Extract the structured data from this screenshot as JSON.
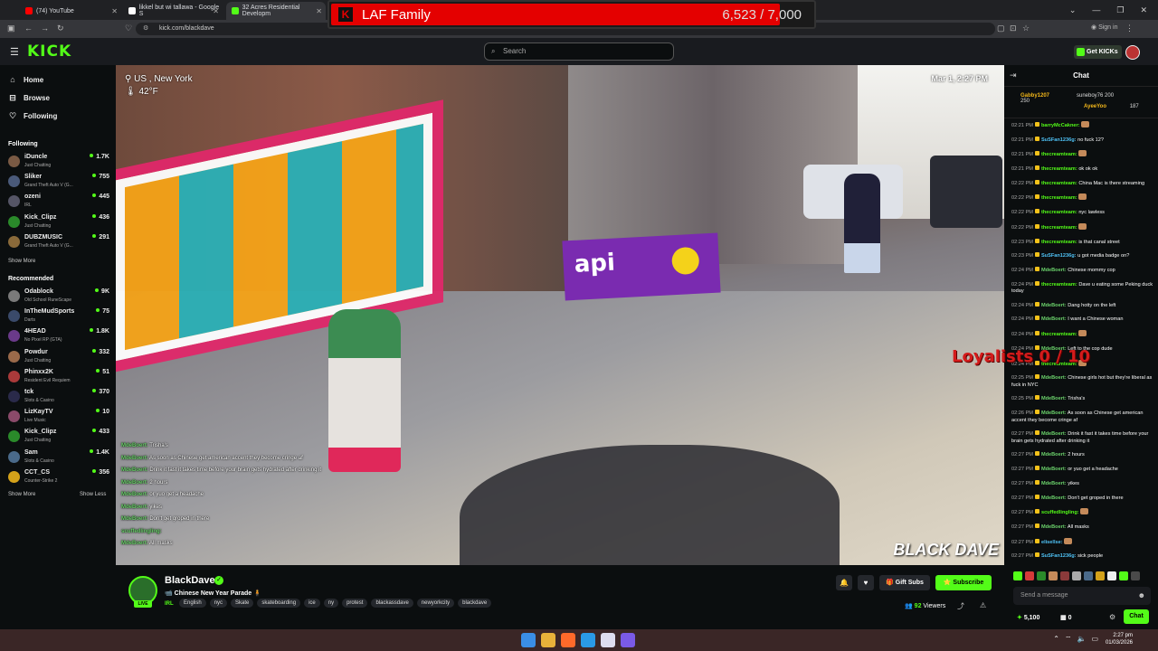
{
  "browser": {
    "tabs": [
      {
        "label": "(74) YouTube"
      },
      {
        "label": "likkel but wi tallawa - Google S"
      },
      {
        "label": "32 Acres Residential Developm"
      }
    ],
    "url": "kick.com/blackdave",
    "signin_label": "Sign in"
  },
  "laf": {
    "name": "LAF Family",
    "count": "6,523 / 7,000",
    "progress": 0.932
  },
  "kick": {
    "logo": "KICK",
    "search_placeholder": "Search",
    "get_kicks": "Get KICKs"
  },
  "sidebar": {
    "nav": [
      {
        "label": "Home",
        "icon": "home-icon"
      },
      {
        "label": "Browse",
        "icon": "browse-icon"
      },
      {
        "label": "Following",
        "icon": "heart-icon"
      }
    ],
    "following_title": "Following",
    "following": [
      {
        "name": "iDuncle",
        "category": "Just Chatting",
        "viewers": "1.7K",
        "color": "#7a5a44"
      },
      {
        "name": "Sliker",
        "category": "Grand Theft Auto V (G...",
        "viewers": "755",
        "color": "#4a5a7a"
      },
      {
        "name": "ozeni",
        "category": "IRL",
        "viewers": "445",
        "color": "#556"
      },
      {
        "name": "Kick_Clipz",
        "category": "Just Chatting",
        "viewers": "436",
        "color": "#2a8a2a"
      },
      {
        "name": "DUBZMUSIC",
        "category": "Grand Theft Auto V (G...",
        "viewers": "291",
        "color": "#8a6a3a"
      }
    ],
    "show_more": "Show More",
    "recommended_title": "Recommended",
    "recommended": [
      {
        "name": "Odablock",
        "category": "Old School RuneScape",
        "viewers": "9K",
        "color": "#7a7a7a"
      },
      {
        "name": "InTheMudSports",
        "category": "Darts",
        "viewers": "75",
        "color": "#3a4a6a"
      },
      {
        "name": "4HEAD",
        "category": "No Pixel RP (GTA)",
        "viewers": "1.8K",
        "color": "#6a3a8a"
      },
      {
        "name": "Powdur",
        "category": "Just Chatting",
        "viewers": "332",
        "color": "#9a6a4a"
      },
      {
        "name": "Phinxx2K",
        "category": "Resident Evil Requiem",
        "viewers": "51",
        "color": "#aa3a3a"
      },
      {
        "name": "tck",
        "category": "Slots & Casino",
        "viewers": "370",
        "color": "#2a2a4a"
      },
      {
        "name": "LizKayTV",
        "category": "Live Music",
        "viewers": "10",
        "color": "#8a4a6a"
      },
      {
        "name": "Kick_Clipz",
        "category": "Just Chatting",
        "viewers": "433",
        "color": "#2a8a2a"
      },
      {
        "name": "Sam",
        "category": "Slots & Casino",
        "viewers": "1.4K",
        "color": "#4a6a8a"
      },
      {
        "name": "CCT_CS",
        "category": "Counter-Strike 2",
        "viewers": "356",
        "color": "#d4a21a"
      }
    ],
    "show_more2": "Show More",
    "show_less": "Show Less"
  },
  "video": {
    "location": "US , New York",
    "temperature": "42°F",
    "datetime": "Mar 1, 2:27 PM",
    "watermark": "BLACK DAVE",
    "banner_text": "api",
    "overlay_chat": [
      {
        "user": "MdeBoert:",
        "text": "Trisha's"
      },
      {
        "user": "MdeBoert:",
        "text": "As soon as Chinese get american accent they become cringe af"
      },
      {
        "user": "MdeBoert:",
        "text": "Drink it fast it takes time before your brain gets hydrated after drinking it"
      },
      {
        "user": "MdeBoert:",
        "text": "2 hours"
      },
      {
        "user": "MdeBoert:",
        "text": "or yuo get a headache"
      },
      {
        "user": "MdeBoert:",
        "text": "yikes"
      },
      {
        "user": "MdeBoert:",
        "text": "Don't get groped in there"
      },
      {
        "user": "scuffedlingling:",
        "text": ""
      },
      {
        "user": "MdeBoert:",
        "text": "All masks"
      }
    ]
  },
  "stream": {
    "channel": "BlackDave",
    "live": "LIVE",
    "title": "Chinese New Year Parade",
    "category": "IRL",
    "tags": [
      "English",
      "nyc",
      "Skate",
      "skateboarding",
      "ice",
      "ny",
      "protest",
      "blackassdave",
      "newyorkcity",
      "blackdave"
    ],
    "gift_subs": "Gift Subs",
    "subscribe": "Subscribe",
    "viewers_count": "92",
    "viewers_label": "Viewers"
  },
  "chat": {
    "title": "Chat",
    "pinned": [
      {
        "name": "Gabby1207",
        "value": "250"
      },
      {
        "name": "suneboy76",
        "value": "200"
      },
      {
        "name": "AyeeYoo",
        "value": "187"
      }
    ],
    "messages": [
      {
        "time": "02:21 PM",
        "user": "barryMcCakner:",
        "text": "",
        "color": "#53fc18"
      },
      {
        "time": "02:21 PM",
        "user": "SuSFan1236g:",
        "text": "no fuck 12?",
        "color": "#4fc3f7"
      },
      {
        "time": "02:21 PM",
        "user": "thecreamteam:",
        "text": "",
        "color": "#53fc18"
      },
      {
        "time": "02:21 PM",
        "user": "thecreamteam:",
        "text": "ok ok ok",
        "color": "#53fc18"
      },
      {
        "time": "02:22 PM",
        "user": "thecreamteam:",
        "text": "China Mac is there streaming",
        "color": "#53fc18"
      },
      {
        "time": "02:22 PM",
        "user": "thecreamteam:",
        "text": "",
        "color": "#53fc18"
      },
      {
        "time": "02:22 PM",
        "user": "thecreamteam:",
        "text": "nyc lawless",
        "color": "#53fc18"
      },
      {
        "time": "02:22 PM",
        "user": "thecreamteam:",
        "text": "",
        "color": "#53fc18"
      },
      {
        "time": "02:23 PM",
        "user": "thecreamteam:",
        "text": "is that canal street",
        "color": "#53fc18"
      },
      {
        "time": "02:23 PM",
        "user": "SuSFan1236g:",
        "text": "u got media badge on?",
        "color": "#4fc3f7"
      },
      {
        "time": "02:24 PM",
        "user": "MdeBoert:",
        "text": "Chinese mommy cop",
        "color": "#6bd26b"
      },
      {
        "time": "02:24 PM",
        "user": "thecreamteam:",
        "text": "Dave u eating some Peking duck today",
        "color": "#53fc18"
      },
      {
        "time": "02:24 PM",
        "user": "MdeBoert:",
        "text": "Dang hotty on the left",
        "color": "#6bd26b"
      },
      {
        "time": "02:24 PM",
        "user": "MdeBoert:",
        "text": "I want a Chinese woman",
        "color": "#6bd26b"
      },
      {
        "time": "02:24 PM",
        "user": "thecreamteam:",
        "text": "",
        "color": "#53fc18"
      },
      {
        "time": "02:24 PM",
        "user": "MdeBoert:",
        "text": "Left to the cop dude",
        "color": "#6bd26b"
      },
      {
        "time": "02:24 PM",
        "user": "thecreamteam:",
        "text": "",
        "color": "#53fc18"
      },
      {
        "time": "02:25 PM",
        "user": "MdeBoert:",
        "text": "Chinese girls hot but they're liberal as fuck in NYC",
        "color": "#6bd26b"
      },
      {
        "time": "02:25 PM",
        "user": "MdeBoert:",
        "text": "Trisha's",
        "color": "#6bd26b"
      },
      {
        "time": "02:26 PM",
        "user": "MdeBoert:",
        "text": "As soon as Chinese get american accent they become cringe af",
        "color": "#6bd26b"
      },
      {
        "time": "02:27 PM",
        "user": "MdeBoert:",
        "text": "Drink it fast it takes time before your brain gets hydrated after drinking it",
        "color": "#6bd26b"
      },
      {
        "time": "02:27 PM",
        "user": "MdeBoert:",
        "text": "2 hours",
        "color": "#6bd26b"
      },
      {
        "time": "02:27 PM",
        "user": "MdeBoert:",
        "text": "or yuo get a headache",
        "color": "#6bd26b"
      },
      {
        "time": "02:27 PM",
        "user": "MdeBoert:",
        "text": "yikes",
        "color": "#6bd26b"
      },
      {
        "time": "02:27 PM",
        "user": "MdeBoert:",
        "text": "Don't get groped in there",
        "color": "#6bd26b"
      },
      {
        "time": "02:27 PM",
        "user": "scuffedlingling:",
        "text": "",
        "color": "#53fc18"
      },
      {
        "time": "02:27 PM",
        "user": "MdeBoert:",
        "text": "All masks",
        "color": "#6bd26b"
      },
      {
        "time": "02:27 PM",
        "user": "elisellse:",
        "text": "",
        "color": "#4fc3f7"
      },
      {
        "time": "02:27 PM",
        "user": "SuSFan1236g:",
        "text": "sick people",
        "color": "#4fc3f7"
      }
    ],
    "send_placeholder": "Send a message",
    "kick_balance": "5,100",
    "sub_count": "0",
    "chat_button": "Chat"
  },
  "overlay_text": "Loyalists 0 / 10",
  "taskbar": {
    "time": "2:27 pm",
    "date": "01/03/2026"
  }
}
